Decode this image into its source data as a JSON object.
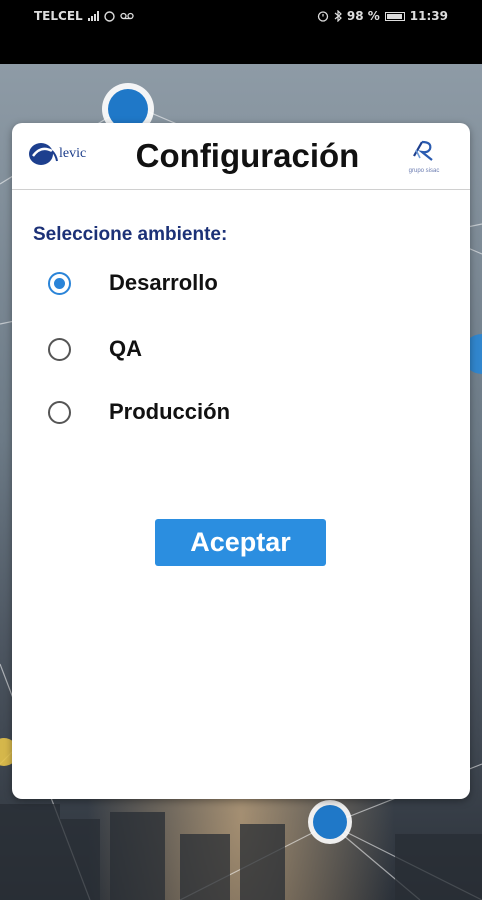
{
  "status_bar": {
    "carrier": "TELCEL",
    "battery": "98 %",
    "time": "11:39",
    "icons": [
      "signal-icon",
      "whatsapp-icon",
      "voicemail-icon",
      "alarm-icon",
      "bluetooth-icon",
      "battery-icon"
    ]
  },
  "dialog": {
    "title": "Configuración",
    "logo_left_text": "levic",
    "logo_right_text": "grupo sisac",
    "prompt": "Seleccione ambiente:",
    "options": [
      {
        "label": "Desarrollo",
        "selected": true
      },
      {
        "label": "QA",
        "selected": false
      },
      {
        "label": "Producción",
        "selected": false
      }
    ],
    "accept_label": "Aceptar"
  },
  "colors": {
    "accent": "#2b8ee0",
    "prompt_text": "#1c3177",
    "radio_selected": "#2a84d8"
  }
}
